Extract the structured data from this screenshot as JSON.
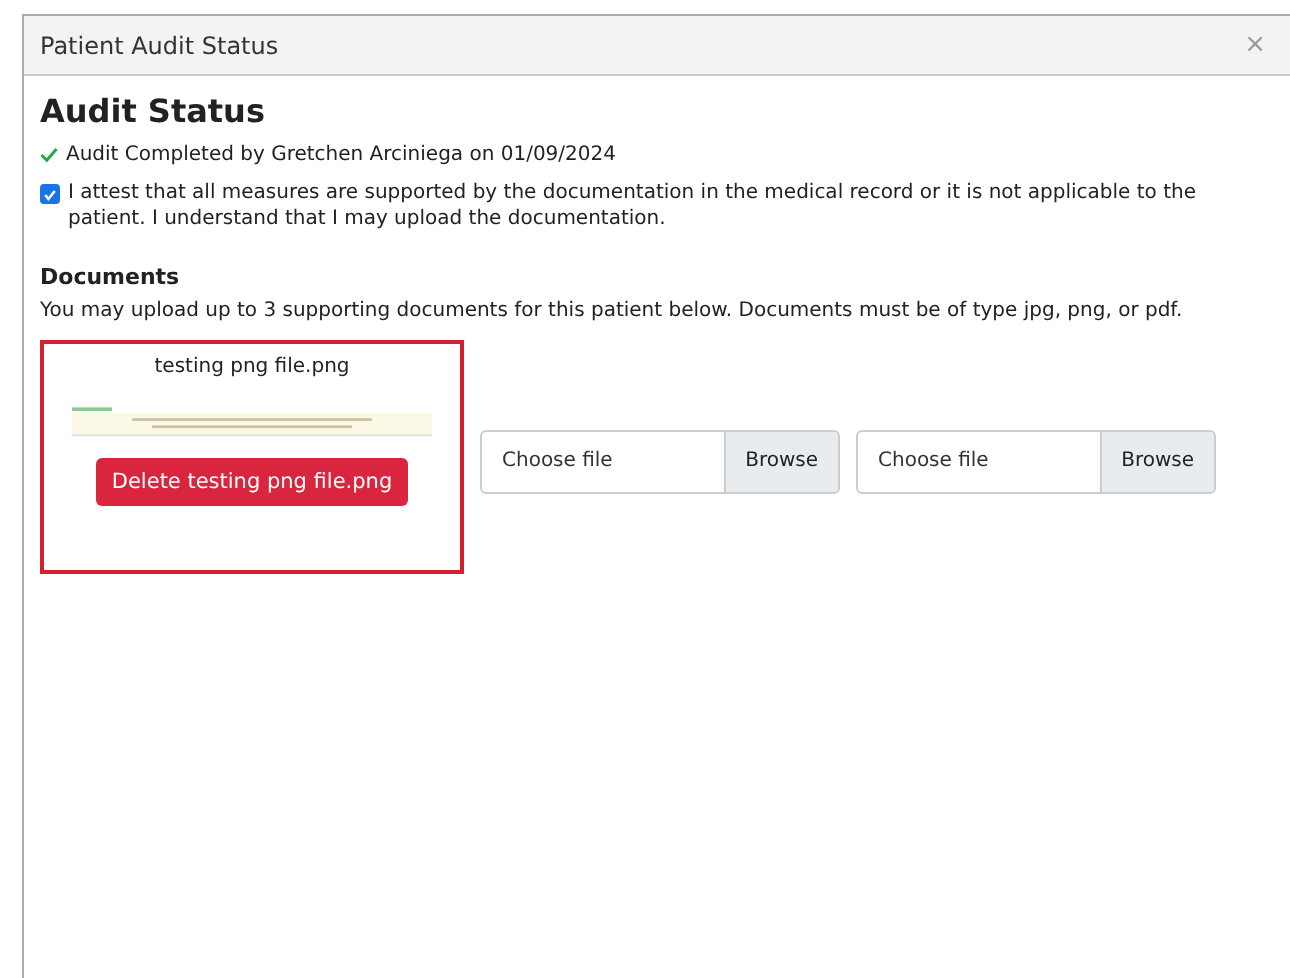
{
  "dialog": {
    "title": "Patient Audit Status",
    "close": "×"
  },
  "heading": "Audit Status",
  "completion": {
    "done": true,
    "text": "Audit Completed by Gretchen Arciniega on 01/09/2024"
  },
  "attest": {
    "checked": true,
    "text": "I attest that all measures are supported by the documentation in the medical record or it is not applicable to the patient. I understand that I may upload the documentation."
  },
  "documents": {
    "heading": "Documents",
    "description": "You may upload up to 3 supporting documents for this patient below. Documents must be of type jpg, png, or pdf.",
    "slots": [
      {
        "kind": "uploaded",
        "selected": true,
        "filename": "testing png file.png",
        "delete_label": "Delete testing png file.png"
      },
      {
        "kind": "empty",
        "placeholder": "Choose file",
        "browse_label": "Browse"
      },
      {
        "kind": "empty",
        "placeholder": "Choose file",
        "browse_label": "Browse"
      }
    ]
  }
}
